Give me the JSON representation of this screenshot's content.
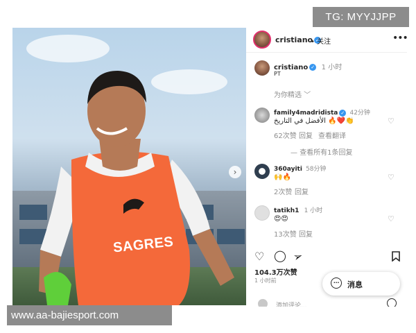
{
  "watermarks": {
    "top": "TG: MYYJJPP",
    "bottom": "www.aa-bajiesport.com"
  },
  "photo": {
    "sponsor_text": "SAGRES",
    "next_icon": "chevron-right-icon"
  },
  "header": {
    "username": "cristiano",
    "follow_label": "关注",
    "more_icon": "more-horizontal-icon"
  },
  "caption": {
    "username": "cristiano",
    "time": "1 小时",
    "text": "PT",
    "translate_label": "为你精选 ﹀"
  },
  "comments": [
    {
      "username": "family4madridista",
      "time": "42分钟",
      "text": "الأفضل في التاريخ 🔥❤️👏",
      "likes": "62次赞",
      "reply": "回复",
      "translate": "查看翻译",
      "replies_link": "查看所有1条回复"
    },
    {
      "username": "360ayiti",
      "time": "58分钟",
      "text": "🙌🔥",
      "likes": "2次赞",
      "reply": "回复"
    },
    {
      "username": "tatikh1",
      "time": "1 小时",
      "text": "😍😍",
      "likes": "13次赞",
      "reply": "回复"
    }
  ],
  "actions": {
    "like_icon": "heart-icon",
    "comment_icon": "comment-icon",
    "share_icon": "send-icon",
    "save_icon": "bookmark-icon"
  },
  "stats": {
    "likes": "104.3万次赞",
    "time_ago": "1 小时前"
  },
  "message_button": {
    "label": "消息"
  },
  "comment_input": {
    "placeholder": "添加评论..."
  },
  "colors": {
    "verified": "#3897f0",
    "muted_text": "#8e8e8e",
    "bib_orange": "#f4693a",
    "story_ring": "#e1306c"
  }
}
